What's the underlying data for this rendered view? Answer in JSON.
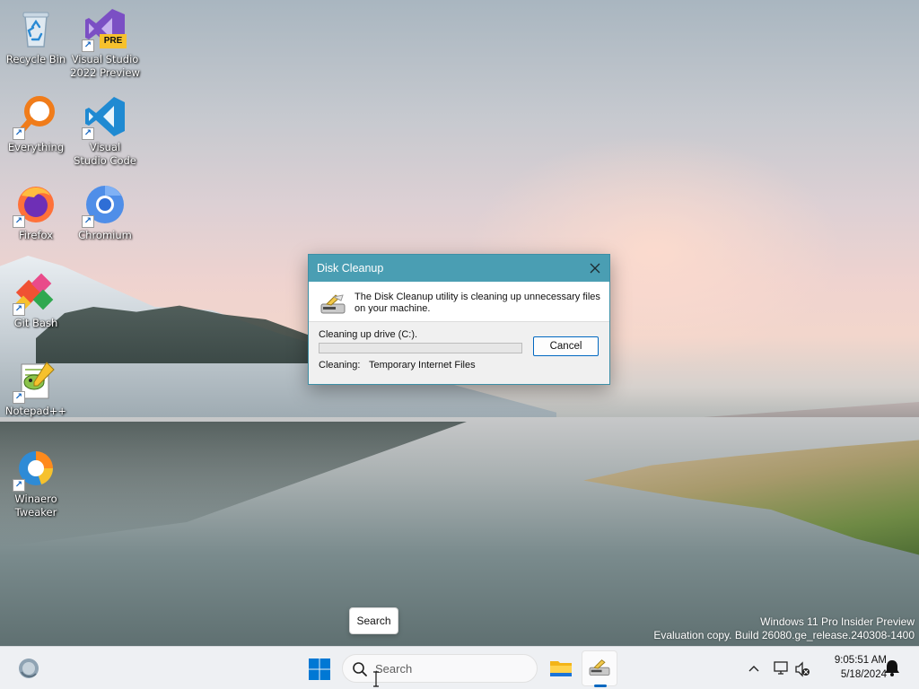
{
  "desktop": {
    "icons": [
      {
        "label": "Recycle Bin",
        "icon": "recycle-bin-icon"
      },
      {
        "label": "Visual Studio 2022 Preview",
        "icon": "visual-studio-icon",
        "badge": "PRE"
      },
      {
        "label": "Everything",
        "icon": "everything-search-icon"
      },
      {
        "label": "Visual Studio Code",
        "icon": "vscode-icon"
      },
      {
        "label": "Firefox",
        "icon": "firefox-icon"
      },
      {
        "label": "Chromium",
        "icon": "chromium-icon"
      },
      {
        "label": "Git Bash",
        "icon": "git-bash-icon"
      },
      {
        "label": "Notepad++",
        "icon": "notepad-plus-plus-icon"
      },
      {
        "label": "Winaero Tweaker",
        "icon": "winaero-tweaker-icon"
      }
    ]
  },
  "dialog": {
    "title": "Disk Cleanup",
    "message": "The Disk Cleanup utility is cleaning up unnecessary files on your machine.",
    "drive_label": "Cleaning up drive  (C:).",
    "progress": 0,
    "cancel_label": "Cancel",
    "cleaning_label": "Cleaning:",
    "cleaning_value": "Temporary Internet Files"
  },
  "tooltip": {
    "text": "Search"
  },
  "watermark": {
    "line1": "Windows 11 Pro Insider Preview",
    "line2": "Evaluation copy. Build 26080.ge_release.240308-1400"
  },
  "taskbar": {
    "search_placeholder": "Search",
    "apps": [
      {
        "name": "File Explorer",
        "icon": "file-explorer-icon",
        "active": false
      },
      {
        "name": "Disk Cleanup",
        "icon": "disk-cleanup-icon",
        "active": true
      }
    ],
    "tray": {
      "time": "9:05:51 AM",
      "date": "5/18/2024"
    }
  },
  "colors": {
    "dialog_title_bg": "#4a9eb3",
    "accent": "#0067c0",
    "taskbar_bg": "#eef0f3"
  }
}
